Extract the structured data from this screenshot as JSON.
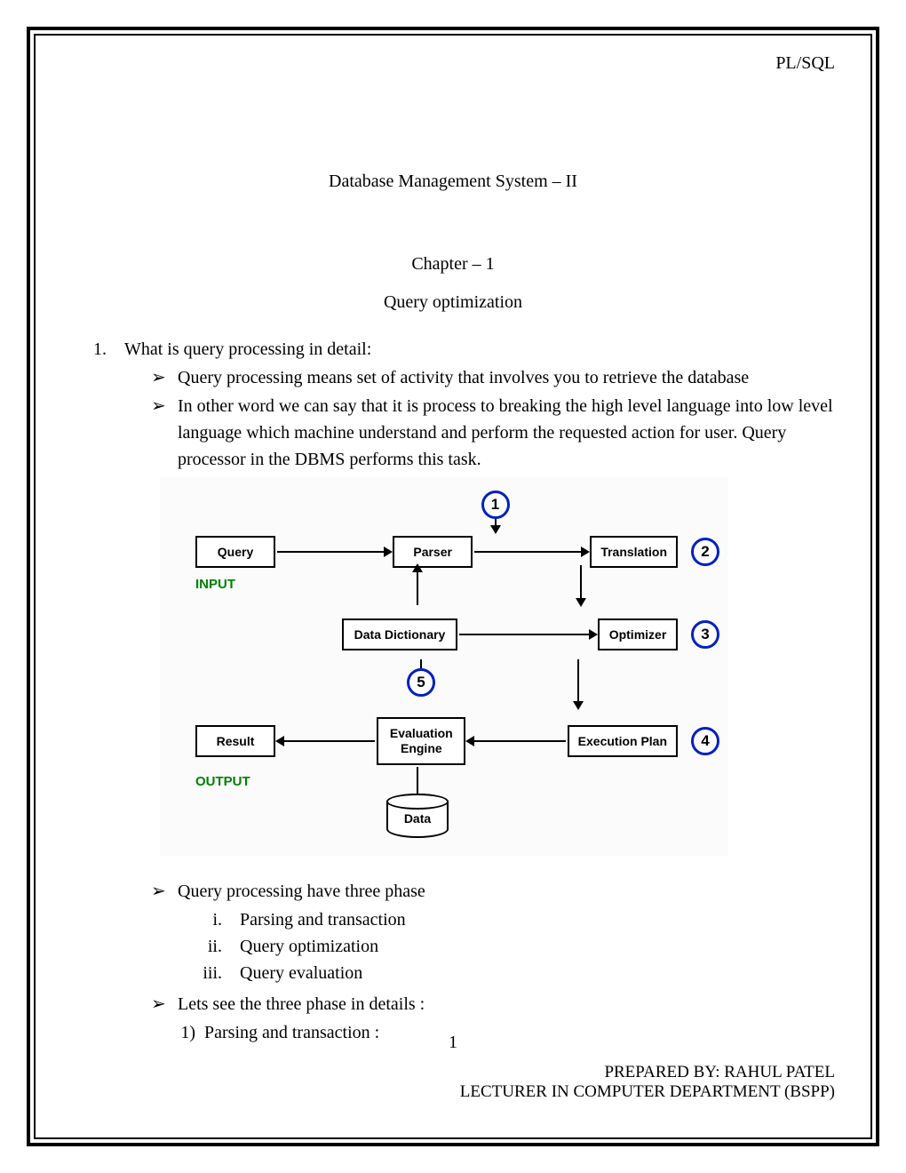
{
  "header": {
    "right": "PL/SQL"
  },
  "title": "Database Management System – II",
  "chapter": "Chapter – 1",
  "subtitle": "Query optimization",
  "question": {
    "num": "1.",
    "text": "What is query processing in detail:"
  },
  "bullets_top": [
    "Query processing means set of activity that involves you to retrieve the database",
    "In other word we can say that it is process to breaking the high level language into low level language which machine understand  and perform the requested action for user. Query processor in the DBMS performs this task."
  ],
  "diagram": {
    "boxes": {
      "query": "Query",
      "parser": "Parser",
      "translation": "Translation",
      "data_dictionary": "Data Dictionary",
      "optimizer": "Optimizer",
      "result": "Result",
      "evaluation": "Evaluation Engine",
      "execution_plan": "Execution Plan",
      "data": "Data"
    },
    "labels": {
      "input": "INPUT",
      "output": "OUTPUT"
    },
    "nums": {
      "n1": "1",
      "n2": "2",
      "n3": "3",
      "n4": "4",
      "n5": "5"
    }
  },
  "bullets_bottom": [
    "Query processing have three phase"
  ],
  "roman": [
    {
      "n": "i.",
      "t": "Parsing and transaction"
    },
    {
      "n": "ii.",
      "t": "Query optimization"
    },
    {
      "n": "iii.",
      "t": "Query evaluation"
    }
  ],
  "bullets_after": [
    "Lets see the three phase in details :"
  ],
  "numbered": [
    {
      "n": "1)",
      "t": "Parsing and transaction :"
    }
  ],
  "page_num": "1",
  "footer": {
    "line1": "PREPARED BY:  RAHUL PATEL",
    "line2": "LECTURER IN COMPUTER DEPARTMENT (BSPP)"
  }
}
